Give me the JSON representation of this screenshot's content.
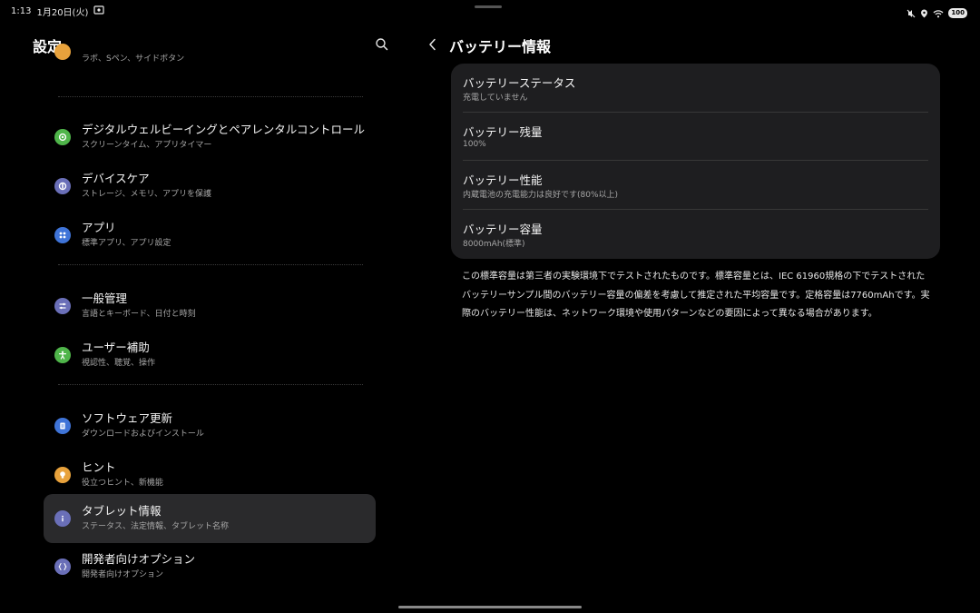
{
  "status_bar": {
    "time": "1:13",
    "date": "1月20日(火)",
    "battery": "100"
  },
  "left_pane": {
    "title": "設定",
    "items": [
      {
        "title": "",
        "subtitle": "ラボ、Sペン、サイドボタン",
        "icon": "advanced-features-icon",
        "color": "#e8a23c"
      },
      {
        "title": "デジタルウェルビーイングとペアレンタルコントロール",
        "subtitle": "スクリーンタイム、アプリタイマー",
        "icon": "wellbeing-icon",
        "color": "#4fb54a"
      },
      {
        "title": "デバイスケア",
        "subtitle": "ストレージ、メモリ、アプリを保護",
        "icon": "device-care-icon",
        "color": "#6a6fb8"
      },
      {
        "title": "アプリ",
        "subtitle": "標準アプリ、アプリ設定",
        "icon": "apps-icon",
        "color": "#3f74d8"
      },
      {
        "title": "一般管理",
        "subtitle": "言語とキーボード、日付と時刻",
        "icon": "general-management-icon",
        "color": "#6a6fb8"
      },
      {
        "title": "ユーザー補助",
        "subtitle": "視認性、聴覚、操作",
        "icon": "accessibility-icon",
        "color": "#4fb54a"
      },
      {
        "title": "ソフトウェア更新",
        "subtitle": "ダウンロードおよびインストール",
        "icon": "software-update-icon",
        "color": "#3f74d8"
      },
      {
        "title": "ヒント",
        "subtitle": "役立つヒント、新機能",
        "icon": "tips-icon",
        "color": "#e8a23c"
      },
      {
        "title": "タブレット情報",
        "subtitle": "ステータス、法定情報、タブレット名称",
        "icon": "info-icon",
        "color": "#6a6fb8"
      },
      {
        "title": "開発者向けオプション",
        "subtitle": "開発者向けオプション",
        "icon": "developer-options-icon",
        "color": "#6a6fb8"
      }
    ]
  },
  "right_pane": {
    "title": "バッテリー情報",
    "rows": [
      {
        "title": "バッテリーステータス",
        "subtitle": "充電していません"
      },
      {
        "title": "バッテリー残量",
        "subtitle": "100%"
      },
      {
        "title": "バッテリー性能",
        "subtitle": "内蔵電池の充電能力は良好です(80%以上)"
      },
      {
        "title": "バッテリー容量",
        "subtitle": "8000mAh(標準)"
      }
    ],
    "note": "この標準容量は第三者の実験環境下でテストされたものです。標準容量とは、IEC 61960規格の下でテストされたバッテリーサンプル間のバッテリー容量の偏差を考慮して推定された平均容量です。定格容量は7760mAhです。実際のバッテリー性能は、ネットワーク環境や使用パターンなどの要因によって異なる場合があります。"
  }
}
